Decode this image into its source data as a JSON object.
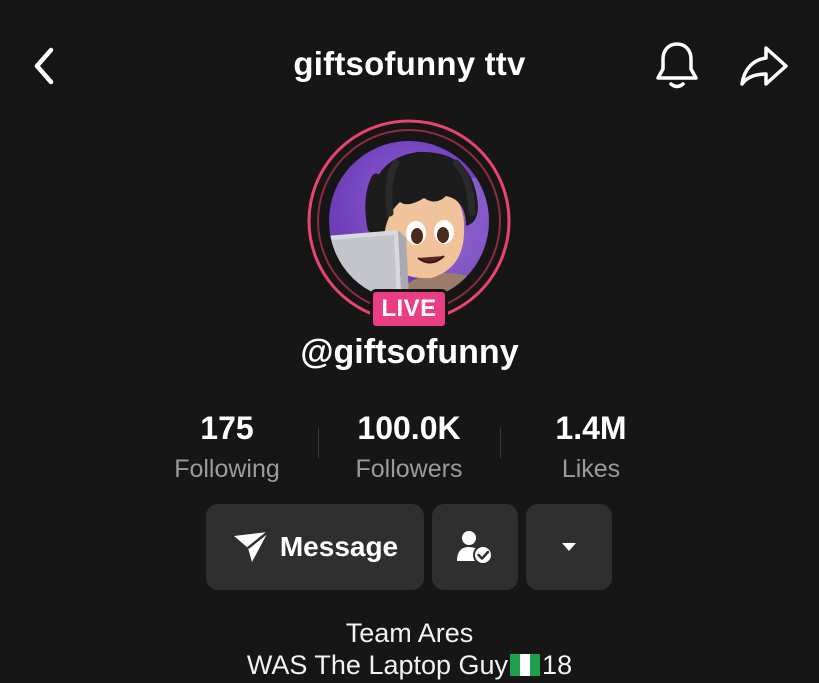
{
  "header": {
    "title": "giftsofunny ttv"
  },
  "icons": {
    "back": "chevron-left-icon",
    "bell": "bell-icon",
    "share": "share-arrow-icon",
    "message": "paper-plane-icon",
    "followed": "user-check-icon",
    "more": "caret-down-icon",
    "flag": "nigeria-flag-icon"
  },
  "profile": {
    "live_badge": "LIVE",
    "username": "@giftsofunny"
  },
  "stats": [
    {
      "value": "175",
      "label": "Following"
    },
    {
      "value": "100.0K",
      "label": "Followers"
    },
    {
      "value": "1.4M",
      "label": "Likes"
    }
  ],
  "actions": {
    "message_label": "Message"
  },
  "bio": {
    "line1": "Team Ares",
    "line2_prefix": "WAS The Laptop Guy",
    "line2_suffix": "18"
  },
  "colors": {
    "background": "#161616",
    "live": "#ea3d83",
    "ring": "#e8446f",
    "button": "#2f2f2f",
    "muted_text": "#9b9b9b"
  }
}
